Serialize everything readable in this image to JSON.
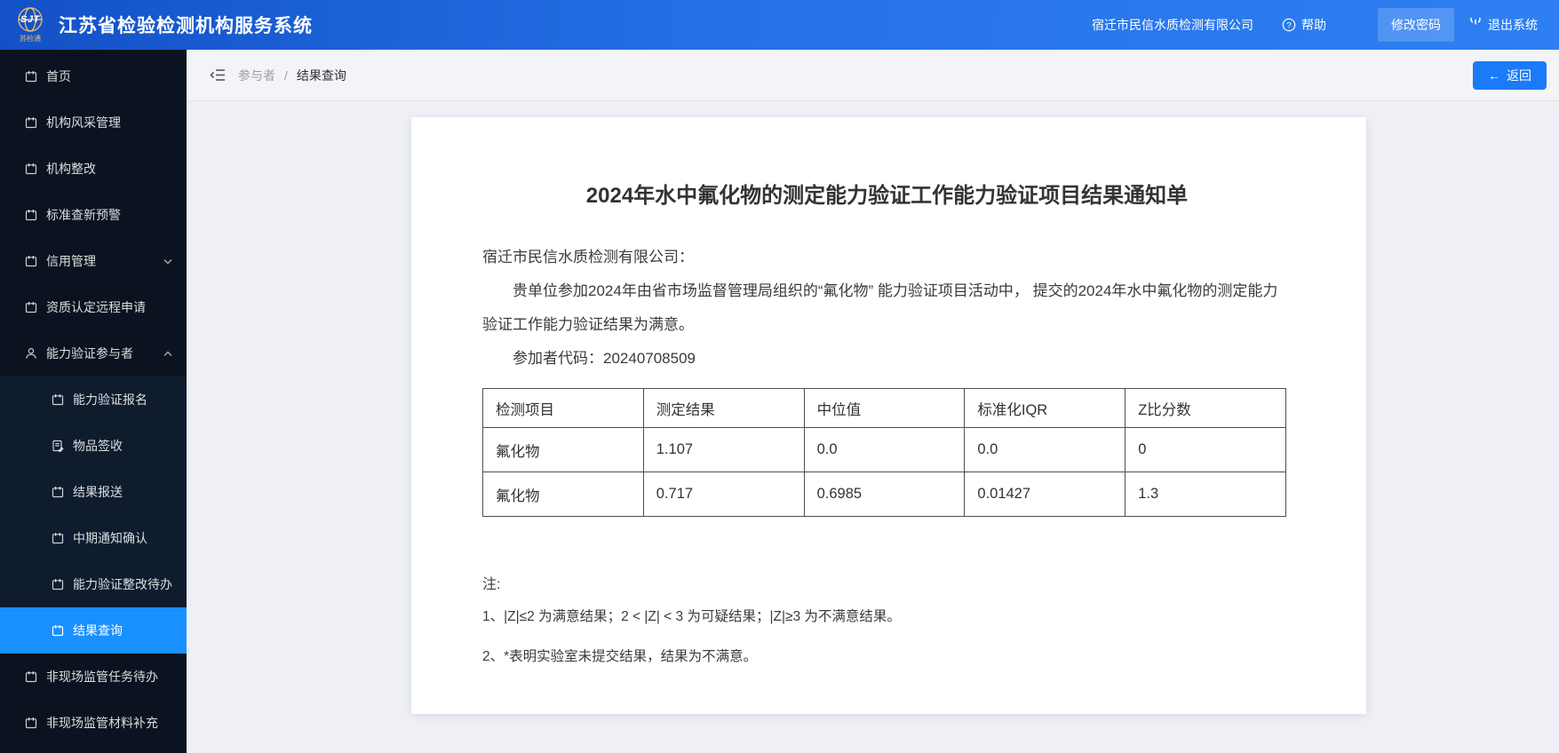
{
  "colors": {
    "accent": "#1890ff",
    "header_gradient_start": "#1351c6",
    "header_gradient_end": "#2e80f2",
    "sidebar_bg": "#0a131f",
    "submenu_bg": "#0e1c2e",
    "active_item_bg": "#1890ff",
    "content_bg": "#eef0f5",
    "paper_bg": "#ffffff",
    "logo_gold": "#e7b96a"
  },
  "header": {
    "logo_abbr": "SJT",
    "logo_caption": "苏检通",
    "title": "江苏省检验检测机构服务系统",
    "company": "宿迁市民信水质检测有限公司",
    "help_label": "帮助",
    "change_password_label": "修改密码",
    "logout_label": "退出系统"
  },
  "sidebar": {
    "items": [
      {
        "label": "首页",
        "icon": "calendar-icon"
      },
      {
        "label": "机构风采管理",
        "icon": "calendar-icon"
      },
      {
        "label": "机构整改",
        "icon": "calendar-icon"
      },
      {
        "label": "标准查新预警",
        "icon": "calendar-icon"
      },
      {
        "label": "信用管理",
        "icon": "calendar-icon",
        "chevron": "down"
      },
      {
        "label": "资质认定远程申请",
        "icon": "calendar-icon"
      },
      {
        "label": "能力验证参与者",
        "icon": "user-icon",
        "chevron": "up",
        "expanded": true,
        "children": [
          {
            "label": "能力验证报名",
            "icon": "calendar-icon"
          },
          {
            "label": "物品签收",
            "icon": "clipboard-icon"
          },
          {
            "label": "结果报送",
            "icon": "calendar-icon"
          },
          {
            "label": "中期通知确认",
            "icon": "calendar-icon"
          },
          {
            "label": "能力验证整改待办",
            "icon": "calendar-icon"
          },
          {
            "label": "结果查询",
            "icon": "calendar-icon",
            "active": true
          }
        ]
      },
      {
        "label": "非现场监管任务待办",
        "icon": "calendar-icon"
      },
      {
        "label": "非现场监管材料补充",
        "icon": "calendar-icon"
      }
    ]
  },
  "breadcrumb": {
    "parent": "参与者",
    "separator": "/",
    "current": "结果查询"
  },
  "toolbar": {
    "back_arrow": "←",
    "back_label": "返回"
  },
  "document": {
    "title": "2024年水中氟化物的测定能力验证工作能力验证项目结果通知单",
    "salutation": "宿迁市民信水质检测有限公司：",
    "paragraph": "贵单位参加2024年由省市场监督管理局组织的“氟化物” 能力验证项目活动中， 提交的2024年水中氟化物的测定能力验证工作能力验证结果为满意。",
    "participant_code_label": "参加者代码：",
    "participant_code": "20240708509",
    "table": {
      "headers": [
        "检测项目",
        "测定结果",
        "中位值",
        "标准化IQR",
        "Z比分数"
      ],
      "rows": [
        [
          "氟化物",
          "1.107",
          "0.0",
          "0.0",
          "0"
        ],
        [
          "氟化物",
          "0.717",
          "0.6985",
          "0.01427",
          "1.3"
        ]
      ]
    },
    "notes": {
      "label": "注:",
      "items": [
        "1、|Z|≤2 为满意结果；2 < |Z| < 3 为可疑结果；|Z|≥3 为不满意结果。",
        "2、*表明实验室未提交结果，结果为不满意。"
      ]
    }
  }
}
